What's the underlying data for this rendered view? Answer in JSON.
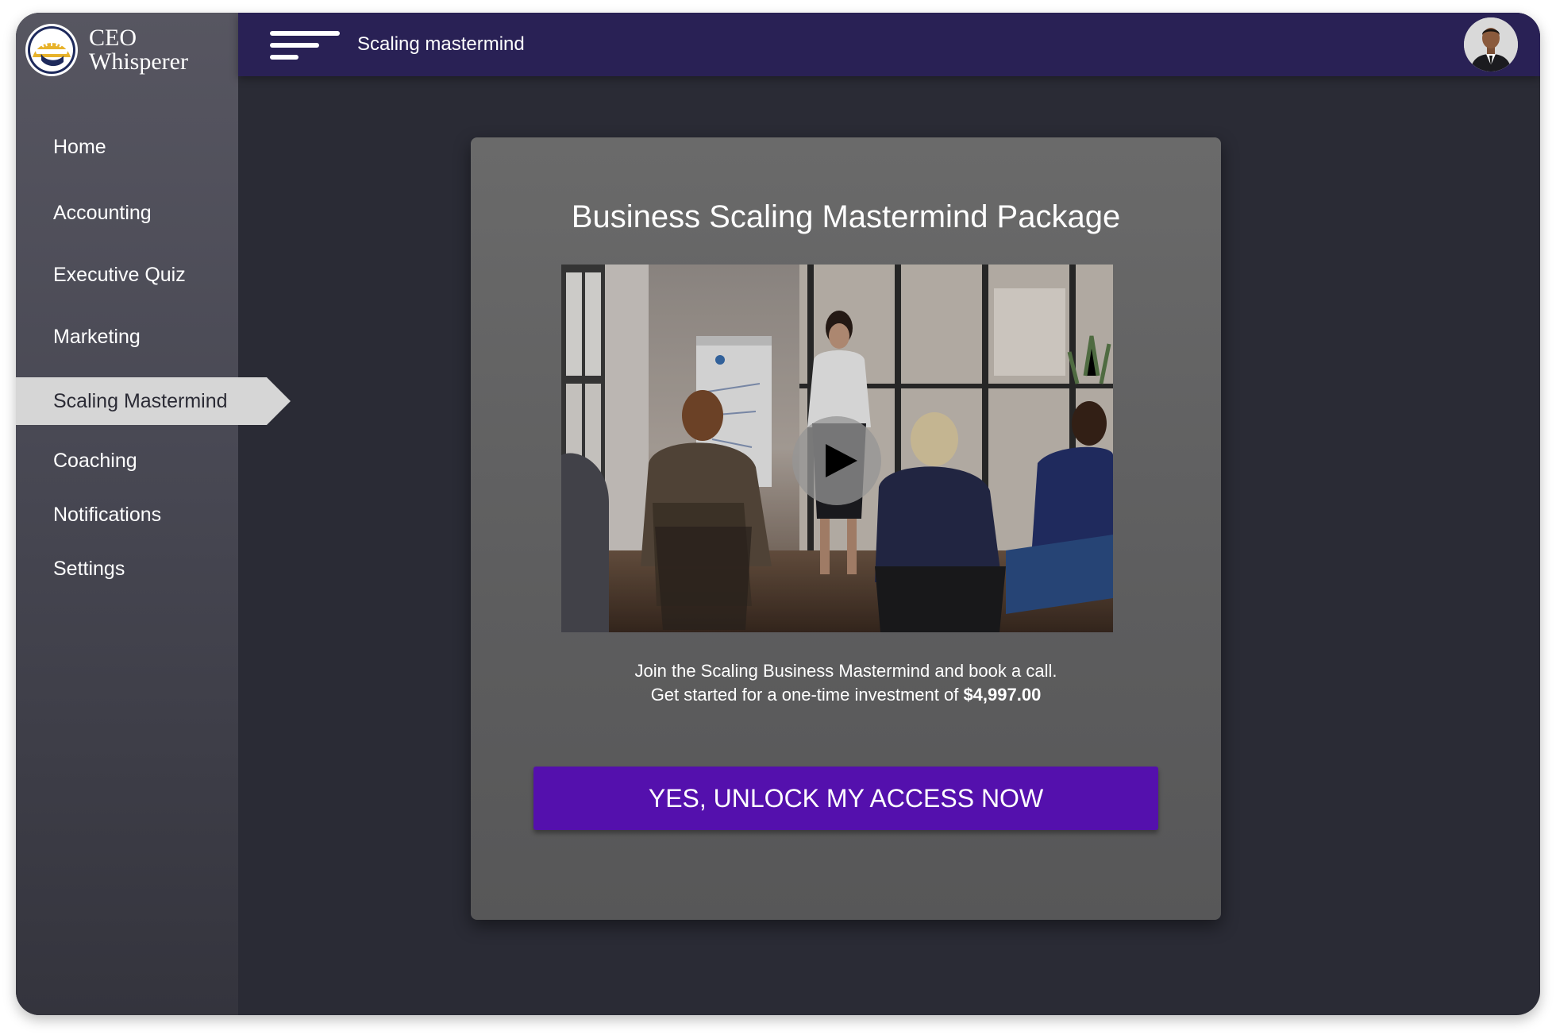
{
  "brand": {
    "line1": "CEO",
    "line2": "Whisperer",
    "logo_icon": "sun-badge-icon",
    "colors": {
      "gold": "#e7b22b",
      "navy": "#1e2a5c"
    }
  },
  "sidebar": {
    "items": [
      {
        "label": "Home",
        "active": false
      },
      {
        "label": "Accounting",
        "active": false
      },
      {
        "label": "Executive Quiz",
        "active": false
      },
      {
        "label": "Marketing",
        "active": false
      },
      {
        "label": "Scaling Mastermind",
        "active": true
      },
      {
        "label": "Coaching",
        "active": false
      },
      {
        "label": "Notifications",
        "active": false
      },
      {
        "label": "Settings",
        "active": false
      }
    ]
  },
  "header": {
    "title": "Scaling mastermind",
    "menu_icon": "hamburger-menu-icon",
    "avatar_icon": "user-avatar",
    "color": "#292155"
  },
  "card": {
    "title": "Business Scaling Mastermind Package",
    "video_icon": "play-icon",
    "desc_line1": "Join the Scaling Business Mastermind and book a call.",
    "desc_line2": "Get started for a one-time investment of",
    "price": "$4,997.00",
    "cta_label": "YES, UNLOCK MY ACCESS NOW",
    "cta_color": "#5410ad"
  }
}
